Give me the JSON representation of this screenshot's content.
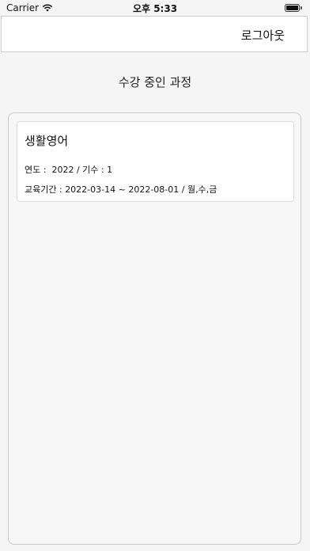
{
  "status_bar": {
    "carrier": "Carrier",
    "time": "오후 5:33"
  },
  "header": {
    "logout_label": "로그아웃"
  },
  "page": {
    "title": "수강 중인 과정"
  },
  "courses": [
    {
      "name": "생활영어",
      "year_label": "연도 :",
      "year": "2022",
      "term_label": "기수 :",
      "term": "1",
      "period_label": "교육기간 :",
      "start_date": "2022-03-14",
      "end_date": "2022-08-01",
      "days": "월,수,금"
    }
  ],
  "icons": {
    "wifi": "wifi-icon",
    "battery": "battery-icon"
  }
}
